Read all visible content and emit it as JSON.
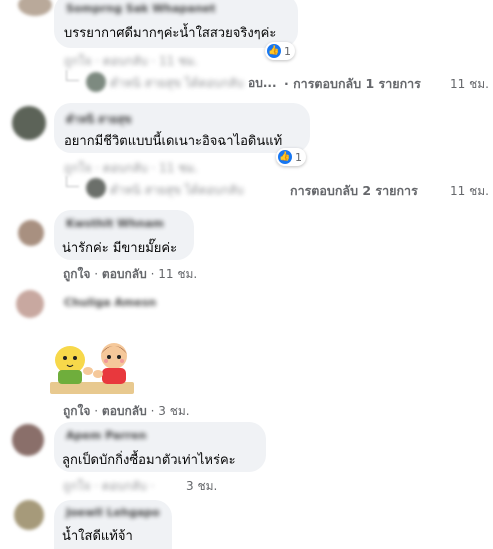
{
  "comments": [
    {
      "name": "Somprng Sak Whapanet",
      "text": "บรรยากาศดีมากๆค่ะน้ำใสสวยจริงๆค่ะ",
      "reaction_count": "1",
      "meta_blurred": "ถูกใจ · ตอบกลับ · 11 ชม.",
      "reply_preview_blurred": "ตำหนิ สายสุข ได้ตอบกลับ",
      "reply_preview_tail": "อบ...",
      "reply_count_label": "· การตอบกลับ 1 รายการ",
      "reply_time": "11 ชม."
    },
    {
      "name": "ตำหนิ สายสุข",
      "text": "อยากมีชีวิตแบบนี้เดเนาะอิจฉาไอดินแท้",
      "reaction_count": "1",
      "meta_blurred": "ถูกใจ · ตอบกลับ · 11 ชม.",
      "reply_preview_blurred": "ตำหนิ สายสุข ได้ตอบกลับ",
      "reply_count_label": "การตอบกลับ 2 รายการ",
      "reply_time": "11 ชม."
    },
    {
      "name": "Kwsthit Whnam",
      "text": "น่ารักค่ะ มีขายมั๊ยค่ะ",
      "like_label": "ถูกใจ",
      "reply_label": "ตอบกลับ",
      "time": "11 ชม."
    },
    {
      "name": "Chuliga Amesn",
      "sticker_name": "sticker-cartoon-couple",
      "like_label": "ถูกใจ",
      "reply_label": "ตอบกลับ",
      "time": "3 ชม."
    },
    {
      "name": "Apem Parren",
      "text": "ลูกเป็ดบักกิ่งซื้อมาตัวเท่าไหร่คะ",
      "meta_blurred": "ถูกใจ · ตอบกลับ ·",
      "time": "3 ชม."
    },
    {
      "name": "Joewll Lehgapo",
      "text": "น้ำใสดีแท้จ้า"
    }
  ],
  "separator": "·",
  "colors": {
    "bubble": "#f0f2f5",
    "meta": "#65676b",
    "like": "#1877f2"
  }
}
